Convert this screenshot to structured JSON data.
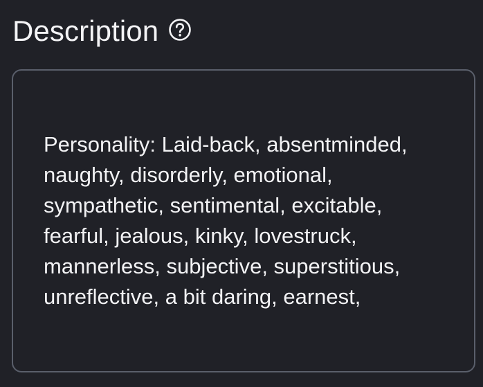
{
  "header": {
    "title": "Description",
    "help_icon": "question-circle-icon"
  },
  "description": {
    "value": "Personality: Laid-back, absentminded,\nnaughty, disorderly, emotional,\nsympathetic, sentimental, excitable,\nfearful, jealous, kinky, lovestruck,\nmannerless, subjective, superstitious,\nunreflective, a bit daring, earnest,"
  },
  "colors": {
    "background": "#202127",
    "border": "#5a5f6b",
    "text": "#f2f2f4"
  }
}
